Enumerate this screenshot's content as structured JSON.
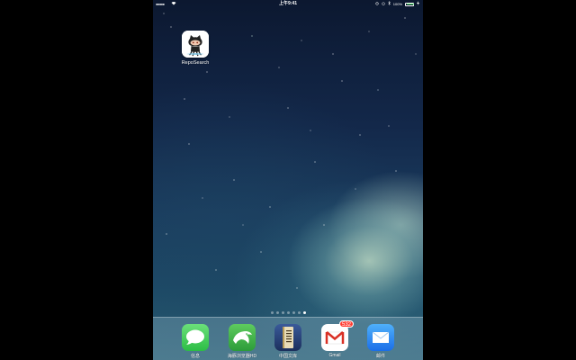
{
  "status_bar": {
    "signal": "●●●●●",
    "wifi_icon": "wifi-icon",
    "time": "上午9:41",
    "icons": [
      "orientation-lock-icon",
      "alarm-icon",
      "bluetooth-icon"
    ],
    "battery_percent": "100%",
    "battery_level": 1.0,
    "battery_color": "#4cd964"
  },
  "home": {
    "apps": [
      {
        "label": "RepoSearch",
        "icon": "github-octocat-icon"
      }
    ]
  },
  "page_dots": {
    "count": 7,
    "active_index": 6
  },
  "dock": {
    "apps": [
      {
        "label": "信息",
        "icon": "messages-icon",
        "color": "#4cd964"
      },
      {
        "label": "海豚浏览器HD",
        "icon": "dolphin-icon",
        "color": "#3fb64c"
      },
      {
        "label": "中国文库",
        "icon": "book-icon",
        "color": "#2a4a8a"
      },
      {
        "label": "Gmail",
        "icon": "gmail-icon",
        "color": "#ffffff",
        "badge": "532"
      },
      {
        "label": "邮件",
        "icon": "mail-icon",
        "color": "#1a7ef0"
      }
    ]
  }
}
